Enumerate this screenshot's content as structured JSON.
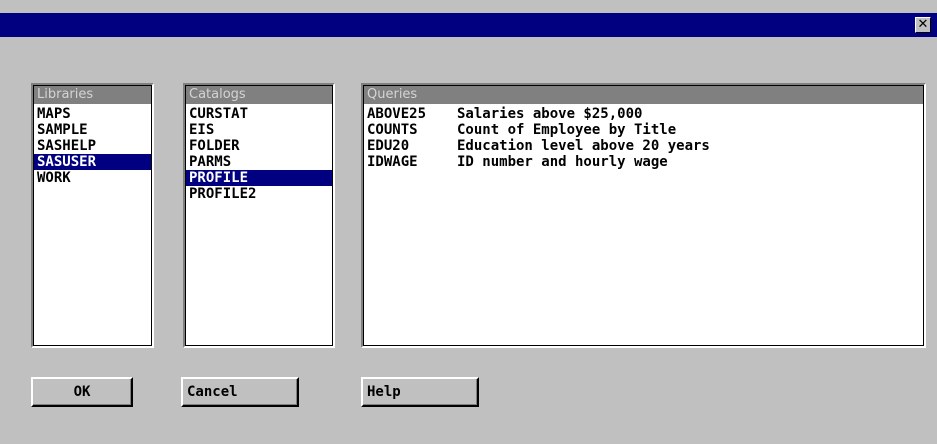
{
  "window": {
    "close_glyph": "✕"
  },
  "libraries": {
    "header": "Libraries",
    "items": [
      "MAPS",
      "SAMPLE",
      "SASHELP",
      "SASUSER",
      "WORK"
    ],
    "selected": "SASUSER"
  },
  "catalogs": {
    "header": "Catalogs",
    "items": [
      "CURSTAT",
      "EIS",
      "FOLDER",
      "PARMS",
      "PROFILE",
      "PROFILE2"
    ],
    "selected": "PROFILE"
  },
  "queries": {
    "header": "Queries",
    "rows": [
      {
        "name": "ABOVE25",
        "desc": "Salaries above $25,000"
      },
      {
        "name": "COUNTS",
        "desc": "Count of Employee by Title"
      },
      {
        "name": "EDU20",
        "desc": "Education level above 20 years"
      },
      {
        "name": "IDWAGE",
        "desc": "ID number and hourly wage"
      }
    ]
  },
  "buttons": {
    "ok": "OK",
    "cancel": "Cancel",
    "help": "Help"
  },
  "colors": {
    "title_bar": "#000080",
    "selection": "#000080",
    "dialog_bg": "#c0c0c0",
    "list_header": "#808080"
  }
}
